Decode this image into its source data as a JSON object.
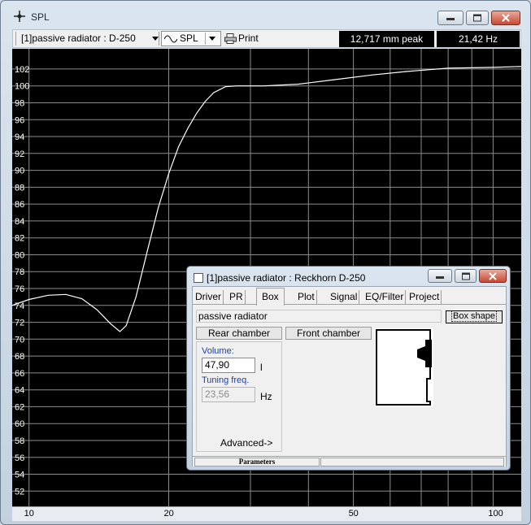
{
  "window": {
    "title": "SPL"
  },
  "toolbar": {
    "driver_select": "[1]passive radiator : D-250",
    "spl_button": "SPL",
    "print_button": "Print",
    "readout_peak": "12,717 mm peak",
    "readout_freq": "21,42 Hz"
  },
  "chart_data": {
    "type": "line",
    "title": "",
    "xlabel": "",
    "ylabel": "",
    "xscale": "log",
    "xlim": [
      9.2,
      115
    ],
    "ylim": [
      50.2,
      104.4
    ],
    "grid": true,
    "x_ticks": [
      "10",
      "20",
      "50",
      "100"
    ],
    "y_ticks": [
      102,
      100,
      98,
      96,
      94,
      92,
      90,
      88,
      86,
      84,
      82,
      80,
      78,
      76,
      74,
      72,
      70,
      68,
      66,
      64,
      62,
      60,
      58,
      56,
      54,
      52
    ],
    "series": [
      {
        "color": "#ffffff",
        "points": [
          [
            9.2,
            74.0
          ],
          [
            10.0,
            74.7
          ],
          [
            11.0,
            75.2
          ],
          [
            12.0,
            75.3
          ],
          [
            13.0,
            74.8
          ],
          [
            14.0,
            73.5
          ],
          [
            15.0,
            71.8
          ],
          [
            15.7,
            70.9
          ],
          [
            16.2,
            71.6
          ],
          [
            17.0,
            75.0
          ],
          [
            18.0,
            80.5
          ],
          [
            19.0,
            85.6
          ],
          [
            20.0,
            89.6
          ],
          [
            21.0,
            92.8
          ],
          [
            22.0,
            95.0
          ],
          [
            23.0,
            96.8
          ],
          [
            24.0,
            98.2
          ],
          [
            25.0,
            99.2
          ],
          [
            26.5,
            99.9
          ],
          [
            28.0,
            100.0
          ],
          [
            32.0,
            100.0
          ],
          [
            38.0,
            100.2
          ],
          [
            45.0,
            100.7
          ],
          [
            55.0,
            101.3
          ],
          [
            65.0,
            101.7
          ],
          [
            80.0,
            102.1
          ],
          [
            100.0,
            102.2
          ],
          [
            115.0,
            102.3
          ]
        ]
      }
    ]
  },
  "dialog": {
    "title": "[1]passive radiator : Reckhorn D-250",
    "tabs": [
      "Driver",
      "PR",
      "Box",
      "Plot",
      "Signal",
      "EQ/Filter",
      "Project"
    ],
    "active_tab": "Box",
    "box_name": "passive radiator",
    "box_shape_button": "Box shape",
    "rear_chamber_button": "Rear chamber",
    "front_chamber_button": "Front chamber",
    "volume_label": "Volume:",
    "volume_value": "47,90",
    "volume_unit": "l",
    "tuning_label": "Tuning freq.",
    "tuning_value": "23,56",
    "tuning_unit": "Hz",
    "advanced_link": "Advanced->",
    "status_parameters": "Parameters"
  }
}
